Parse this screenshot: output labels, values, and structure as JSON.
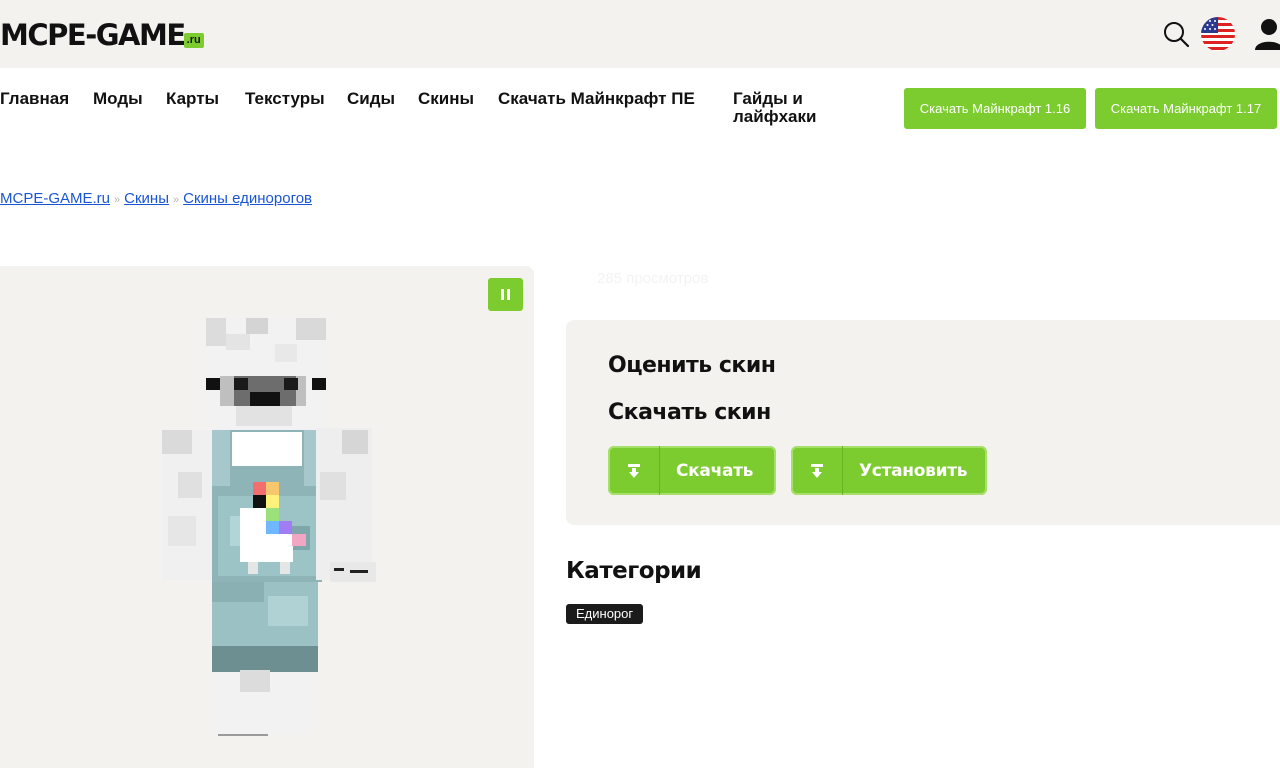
{
  "header": {
    "logo_text": "MCPE-GAME",
    "logo_suffix": ".ru",
    "icons": [
      "search-icon",
      "us-flag-icon",
      "user-icon"
    ]
  },
  "nav": {
    "items": [
      {
        "label": "Главная"
      },
      {
        "label": "Моды"
      },
      {
        "label": "Карты"
      },
      {
        "label": "Текстуры"
      },
      {
        "label": "Сиды"
      },
      {
        "label": "Скины"
      },
      {
        "label": "Скачать Майнкрафт ПЕ"
      },
      {
        "label": "Гайды и лайфхаки"
      }
    ],
    "download_buttons": [
      {
        "label": "Скачать Майнкрафт 1.16"
      },
      {
        "label": "Скачать Майнкрафт 1.17"
      }
    ]
  },
  "breadcrumb": {
    "items": [
      "MCPE-GAME.ru",
      "Скины",
      "Скины единорогов"
    ],
    "separator": "»"
  },
  "skin": {
    "views": "285 просмотров"
  },
  "card": {
    "rate_title": "Оценить скин",
    "download_title": "Скачать скин",
    "download_label": "Скачать",
    "install_label": "Установить"
  },
  "categories": {
    "title": "Категории",
    "tags": [
      "Единорог"
    ]
  },
  "colors": {
    "accent": "#7ccc2f",
    "panel": "#f4f2ee",
    "link": "#1a55d4",
    "tag_bg": "#1b1b1b"
  }
}
